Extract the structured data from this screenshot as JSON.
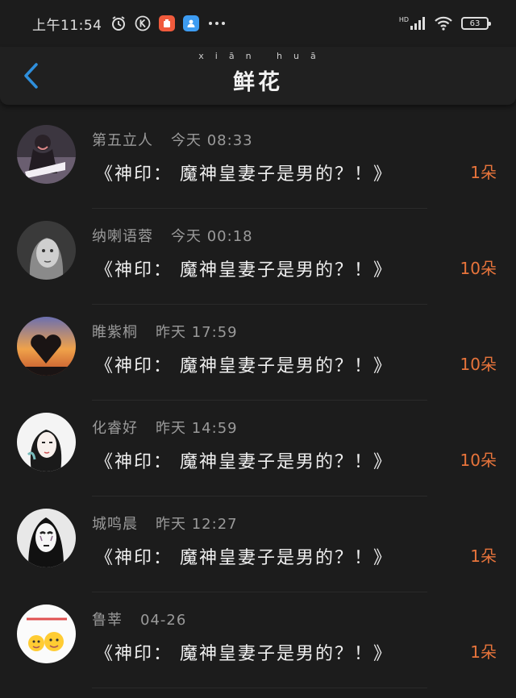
{
  "status_bar": {
    "time": "上午11:54",
    "network": "HD",
    "battery": "63"
  },
  "header": {
    "title": "鲜花",
    "title_pinyin": "xiān huā"
  },
  "colors": {
    "accent_back": "#2f8fdc",
    "count": "#e8743b"
  },
  "rows": [
    {
      "name": "第五立人",
      "time": "今天 08:33",
      "message": "《神印： 魔神皇妻子是男的？！》",
      "count": "1朵",
      "avatar": "avatar-girl-night"
    },
    {
      "name": "纳喇语蓉",
      "time": "今天 00:18",
      "message": "《神印： 魔神皇妻子是男的？！》",
      "count": "10朵",
      "avatar": "avatar-girl-portrait"
    },
    {
      "name": "睢紫桐",
      "time": "昨天 17:59",
      "message": "《神印： 魔神皇妻子是男的？！》",
      "count": "10朵",
      "avatar": "avatar-heart-sunset"
    },
    {
      "name": "化睿好",
      "time": "昨天 14:59",
      "message": "《神印： 魔神皇妻子是男的？！》",
      "count": "10朵",
      "avatar": "avatar-girl-sketch"
    },
    {
      "name": "城鸣晨",
      "time": "昨天 12:27",
      "message": "《神印： 魔神皇妻子是男的？！》",
      "count": "1朵",
      "avatar": "avatar-no-face"
    },
    {
      "name": "鲁莘",
      "time": "04-26",
      "message": "《神印： 魔神皇妻子是男的？！》",
      "count": "1朵",
      "avatar": "avatar-emoji"
    }
  ]
}
